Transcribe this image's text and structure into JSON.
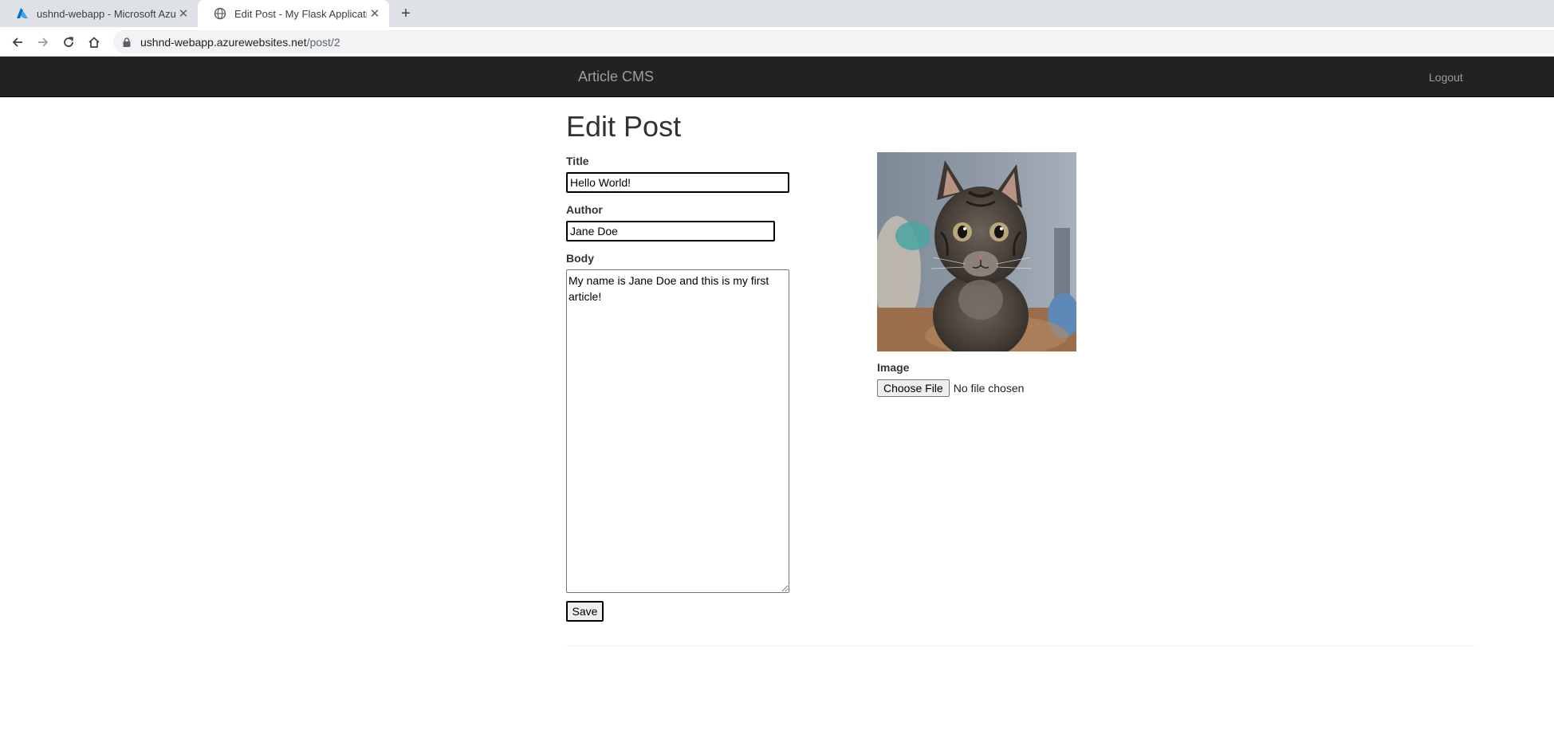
{
  "browser": {
    "tabs": [
      {
        "title": "ushnd-webapp - Microsoft Azure",
        "favicon": "azure-icon",
        "active": false
      },
      {
        "title": "Edit Post - My Flask Application",
        "favicon": "globe-icon",
        "active": true
      }
    ],
    "url_host": "ushnd-webapp.azurewebsites.net",
    "url_path": "/post/2"
  },
  "navbar": {
    "brand": "Article CMS",
    "logout": "Logout",
    "background": "#222222"
  },
  "page": {
    "heading": "Edit Post",
    "title_label": "Title",
    "title_value": "Hello World!",
    "author_label": "Author",
    "author_value": "Jane Doe",
    "body_label": "Body",
    "body_value": "My name is Jane Doe and this is my first article!",
    "save_label": "Save",
    "image_label": "Image",
    "choose_file_label": "Choose File",
    "no_file_text": "No file chosen"
  }
}
